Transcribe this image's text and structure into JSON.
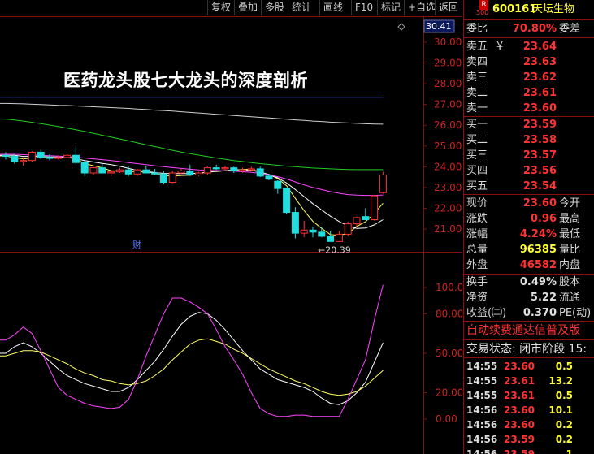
{
  "toolbar": {
    "items": [
      "复权",
      "叠加",
      "多股",
      "统计",
      "画线",
      "F10",
      "标记",
      "+自选",
      "返回"
    ]
  },
  "overlay_title": "医药龙头股七大龙头的深度剖析",
  "header": {
    "r_badge": "R",
    "r_sub": "300",
    "code": "600161",
    "name": "天坛生物"
  },
  "order_book": {
    "weibi_label": "委比",
    "weibi_value": "70.80%",
    "weicha_label": "委差",
    "sells": [
      {
        "label": "卖五",
        "price": "23.64",
        "mark": "¥"
      },
      {
        "label": "卖四",
        "price": "23.63",
        "mark": ""
      },
      {
        "label": "卖三",
        "price": "23.62",
        "mark": ""
      },
      {
        "label": "卖二",
        "price": "23.61",
        "mark": ""
      },
      {
        "label": "卖一",
        "price": "23.60",
        "mark": ""
      }
    ],
    "buys": [
      {
        "label": "买一",
        "price": "23.59"
      },
      {
        "label": "买二",
        "price": "23.58"
      },
      {
        "label": "买三",
        "price": "23.57"
      },
      {
        "label": "买四",
        "price": "23.56"
      },
      {
        "label": "买五",
        "price": "23.54"
      }
    ]
  },
  "stats": [
    {
      "label": "现价",
      "value": "23.60",
      "extra": "今开",
      "color": "#ff3333"
    },
    {
      "label": "涨跌",
      "value": "0.96",
      "extra": "最高",
      "color": "#ff3333"
    },
    {
      "label": "涨幅",
      "value": "4.24%",
      "extra": "最低",
      "color": "#ff3333"
    },
    {
      "label": "总量",
      "value": "96385",
      "extra": "量比",
      "color": "#ffff33"
    },
    {
      "label": "外盘",
      "value": "46582",
      "extra": "内盘",
      "color": "#ff3333"
    }
  ],
  "stats2": [
    {
      "label": "换手",
      "value": "0.49%",
      "extra": "股本",
      "color": "#e0e0e0"
    },
    {
      "label": "净资",
      "value": "5.22",
      "extra": "流通",
      "color": "#e0e0e0"
    },
    {
      "label": "收益(㈡)",
      "value": "0.370",
      "extra": "PE(动)",
      "color": "#e0e0e0"
    }
  ],
  "ticker": "自动续费通达信普及版",
  "trade_state": "交易状态: 闭市阶段 15:",
  "ticks": [
    {
      "time": "14:55",
      "price": "23.60",
      "vol": "0.5",
      "pc": "#ff3333",
      "vc": "#ffff33"
    },
    {
      "time": "14:55",
      "price": "23.61",
      "vol": "13.2",
      "pc": "#ff3333",
      "vc": "#ffff33"
    },
    {
      "time": "14:55",
      "price": "23.61",
      "vol": "0.5",
      "pc": "#ff3333",
      "vc": "#ffff33"
    },
    {
      "time": "14:56",
      "price": "23.60",
      "vol": "10.1",
      "pc": "#ff3333",
      "vc": "#ffff33"
    },
    {
      "time": "14:56",
      "price": "23.60",
      "vol": "0.2",
      "pc": "#ff3333",
      "vc": "#ffff33"
    },
    {
      "time": "14:56",
      "price": "23.59",
      "vol": "0.2",
      "pc": "#ff3333",
      "vc": "#ffff33"
    },
    {
      "time": "14:56",
      "price": "23.59",
      "vol": "1",
      "pc": "#ff3333",
      "vc": "#ffff33"
    }
  ],
  "chart_data": [
    {
      "type": "candlestick",
      "price_axis_ticks": [
        "30.00",
        "29.00",
        "28.00",
        "27.00",
        "26.00",
        "25.00",
        "24.00",
        "23.00",
        "22.00",
        "21.00"
      ],
      "ylim": [
        20.2,
        30.6
      ],
      "current_price_tag": "30.41",
      "low_marker": "←20.39",
      "finance_marker": "财",
      "candles": [
        [
          24.55,
          24.7,
          24.35,
          24.5
        ],
        [
          24.5,
          24.6,
          24.15,
          24.25
        ],
        [
          24.25,
          24.45,
          24.05,
          24.3
        ],
        [
          24.3,
          24.75,
          24.25,
          24.7
        ],
        [
          24.7,
          24.8,
          24.35,
          24.45
        ],
        [
          24.45,
          24.6,
          24.3,
          24.4
        ],
        [
          24.4,
          24.55,
          24.35,
          24.45
        ],
        [
          24.45,
          24.6,
          24.4,
          24.55
        ],
        [
          24.55,
          24.95,
          24.1,
          24.2
        ],
        [
          24.2,
          24.3,
          23.55,
          23.7
        ],
        [
          23.7,
          24.0,
          23.6,
          23.95
        ],
        [
          23.95,
          24.15,
          23.85,
          23.7
        ],
        [
          23.7,
          23.85,
          23.55,
          23.75
        ],
        [
          23.75,
          23.95,
          23.7,
          23.85
        ],
        [
          23.85,
          24.0,
          23.55,
          23.65
        ],
        [
          23.65,
          23.9,
          23.55,
          23.85
        ],
        [
          23.85,
          24.05,
          23.75,
          23.7
        ],
        [
          23.7,
          23.9,
          23.6,
          23.65
        ],
        [
          23.65,
          23.8,
          23.15,
          23.25
        ],
        [
          23.25,
          23.8,
          23.2,
          23.7
        ],
        [
          23.7,
          23.9,
          23.65,
          23.8
        ],
        [
          23.8,
          24.1,
          23.55,
          23.6
        ],
        [
          23.6,
          23.75,
          23.55,
          23.7
        ],
        [
          23.7,
          24.0,
          23.6,
          23.95
        ],
        [
          23.95,
          24.1,
          23.85,
          23.9
        ],
        [
          23.9,
          24.05,
          23.85,
          23.95
        ],
        [
          23.95,
          24.0,
          23.7,
          23.8
        ],
        [
          23.8,
          23.95,
          23.7,
          23.85
        ],
        [
          23.85,
          24.0,
          23.8,
          23.9
        ],
        [
          23.9,
          24.0,
          23.5,
          23.55
        ],
        [
          23.55,
          23.65,
          23.35,
          23.4
        ],
        [
          23.3,
          23.35,
          22.7,
          22.95
        ],
        [
          22.95,
          23.0,
          21.7,
          21.8
        ],
        [
          21.8,
          22.05,
          20.55,
          20.8
        ],
        [
          20.8,
          21.4,
          20.6,
          20.95
        ],
        [
          20.95,
          21.1,
          20.6,
          20.85
        ],
        [
          20.85,
          21.1,
          20.6,
          20.65
        ],
        [
          20.65,
          20.9,
          20.39,
          20.4
        ],
        [
          20.4,
          20.9,
          20.4,
          20.75
        ],
        [
          20.75,
          21.35,
          20.65,
          21.25
        ],
        [
          21.25,
          21.6,
          21.15,
          21.55
        ],
        [
          21.6,
          22.0,
          21.45,
          21.45
        ],
        [
          21.45,
          22.65,
          21.4,
          22.6
        ],
        [
          22.75,
          23.75,
          22.7,
          23.6
        ]
      ],
      "ma_lines": [
        {
          "name": "MA5",
          "color": "#ffff66",
          "values": [
            24.52,
            24.44,
            24.38,
            24.42,
            24.44,
            24.43,
            24.41,
            24.51,
            24.37,
            24.15,
            24.05,
            23.95,
            23.81,
            23.8,
            23.79,
            23.74,
            23.77,
            23.69,
            23.57,
            23.55,
            23.58,
            23.59,
            23.62,
            23.8,
            23.77,
            23.81,
            23.85,
            23.87,
            23.89,
            23.73,
            23.63,
            23.43,
            23.09,
            22.48,
            21.89,
            21.37,
            21.03,
            20.73,
            20.7,
            20.79,
            21.12,
            21.35,
            21.75,
            22.24
          ]
        },
        {
          "name": "MA10",
          "color": "#ffffff",
          "values": [
            24.55,
            24.55,
            24.5,
            24.5,
            24.5,
            24.48,
            24.47,
            24.45,
            24.38,
            24.3,
            24.23,
            24.16,
            24.1,
            24.02,
            23.92,
            23.83,
            23.78,
            23.72,
            23.68,
            23.67,
            23.67,
            23.67,
            23.69,
            23.73,
            23.78,
            23.81,
            23.85,
            23.85,
            23.82,
            23.75,
            23.62,
            23.47,
            23.22,
            22.9,
            22.56,
            22.22,
            21.92,
            21.62,
            21.36,
            21.15,
            21.03,
            21.05,
            21.2,
            21.45
          ]
        },
        {
          "name": "MA20",
          "color": "#ff44ff",
          "values": [
            24.6,
            24.6,
            24.58,
            24.56,
            24.55,
            24.53,
            24.51,
            24.49,
            24.46,
            24.42,
            24.38,
            24.34,
            24.3,
            24.25,
            24.2,
            24.15,
            24.1,
            24.05,
            24.0,
            23.96,
            23.92,
            23.88,
            23.85,
            23.83,
            23.82,
            23.8,
            23.79,
            23.76,
            23.73,
            23.68,
            23.61,
            23.52,
            23.41,
            23.27,
            23.13,
            23.0,
            22.9,
            22.8,
            22.72,
            22.66,
            22.63,
            22.62,
            22.62,
            22.64
          ]
        },
        {
          "name": "MA60",
          "color": "#22cc22",
          "values": [
            26.3,
            26.25,
            26.2,
            26.14,
            26.08,
            26.01,
            25.94,
            25.86,
            25.78,
            25.7,
            25.61,
            25.52,
            25.43,
            25.34,
            25.25,
            25.15,
            25.06,
            24.97,
            24.88,
            24.79,
            24.71,
            24.63,
            24.56,
            24.49,
            24.42,
            24.36,
            24.3,
            24.25,
            24.2,
            24.15,
            24.11,
            24.07,
            24.03,
            24.0,
            23.97,
            23.94,
            23.92,
            23.9,
            23.88,
            23.87,
            23.86,
            23.86,
            23.86,
            23.86
          ]
        },
        {
          "name": "MA120",
          "color": "#cfcfcf",
          "values": [
            27.05,
            27.04,
            27.03,
            27.01,
            27.0,
            26.98,
            26.96,
            26.95,
            26.93,
            26.91,
            26.89,
            26.87,
            26.85,
            26.83,
            26.81,
            26.78,
            26.76,
            26.73,
            26.71,
            26.68,
            26.65,
            26.62,
            26.59,
            26.56,
            26.53,
            26.5,
            26.47,
            26.44,
            26.41,
            26.38,
            26.35,
            26.32,
            26.29,
            26.26,
            26.23,
            26.2,
            26.18,
            26.15,
            26.13,
            26.11,
            26.09,
            26.07,
            26.06,
            26.05
          ]
        },
        {
          "name": "MA250",
          "color": "#3344ff",
          "values": [
            27.35,
            27.35,
            27.35,
            27.35,
            27.35,
            27.35,
            27.35,
            27.35,
            27.35,
            27.35,
            27.35,
            27.35,
            27.35,
            27.35,
            27.35,
            27.35,
            27.35,
            27.35,
            27.35,
            27.35,
            27.35,
            27.35,
            27.35,
            27.35,
            27.35,
            27.35,
            27.35,
            27.35,
            27.35,
            27.35,
            27.35,
            27.35,
            27.35,
            27.35,
            27.35,
            27.35,
            27.35,
            27.35,
            27.35,
            27.35,
            27.35,
            27.35,
            27.35,
            27.35
          ]
        }
      ]
    },
    {
      "type": "line",
      "indicator_axis_ticks": [
        "100.00",
        "80.00",
        "50.00",
        "20.00",
        "0.00"
      ],
      "ylim": [
        -10,
        112
      ],
      "series": [
        {
          "name": "K",
          "color": "#ffffff",
          "values": [
            50,
            55,
            58,
            55,
            50,
            44,
            38,
            33,
            30,
            27,
            25,
            23,
            21,
            21,
            24,
            30,
            37,
            44,
            53,
            63,
            72,
            78,
            81,
            80,
            75,
            68,
            60,
            52,
            45,
            38,
            34,
            30,
            28,
            26,
            24,
            21,
            16,
            12,
            11,
            14,
            20,
            28,
            43,
            58
          ]
        },
        {
          "name": "D",
          "color": "#ffff66",
          "values": [
            48,
            50,
            52,
            52,
            51,
            48,
            45,
            42,
            38,
            35,
            33,
            30,
            29,
            27,
            26,
            27,
            29,
            33,
            38,
            45,
            51,
            57,
            60,
            61,
            59,
            57,
            53,
            50,
            46,
            42,
            38,
            35,
            32,
            29,
            27,
            24,
            21,
            19,
            18,
            19,
            21,
            25,
            31,
            37
          ]
        },
        {
          "name": "J",
          "color": "#ff44ff",
          "values": [
            60,
            64,
            70,
            65,
            52,
            38,
            24,
            18,
            15,
            12,
            10,
            9,
            8,
            9,
            15,
            30,
            48,
            64,
            80,
            92,
            92,
            89,
            85,
            80,
            68,
            55,
            45,
            34,
            20,
            8,
            4,
            2,
            2,
            3,
            3,
            2,
            2,
            2,
            2,
            15,
            30,
            45,
            75,
            102
          ]
        }
      ]
    }
  ]
}
